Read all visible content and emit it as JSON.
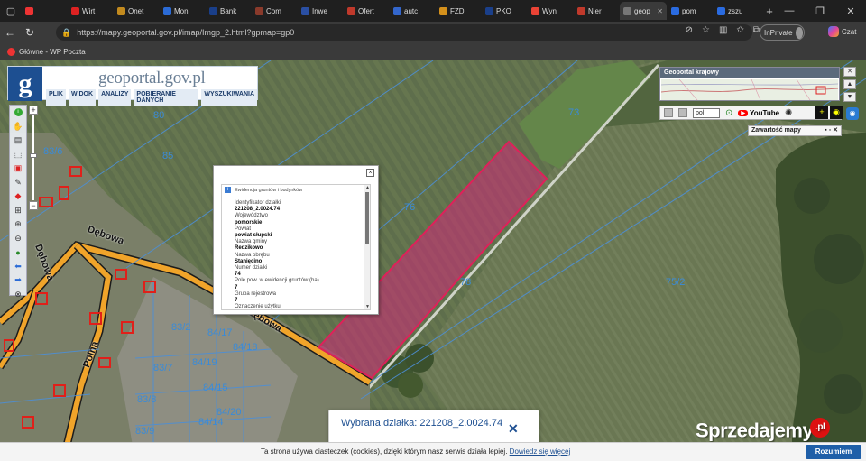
{
  "browser": {
    "tabs": [
      {
        "label": "",
        "color": "#e33"
      },
      {
        "label": "Wirt",
        "color": "#d22"
      },
      {
        "label": "Onet",
        "color": "#c28a1e"
      },
      {
        "label": "Mon",
        "color": "#2b6bd6"
      },
      {
        "label": "Bank",
        "color": "#1a3f8a"
      },
      {
        "label": "Com",
        "color": "#8a3a2b"
      },
      {
        "label": "Inwe",
        "color": "#2a4fa3"
      },
      {
        "label": "Ofert",
        "color": "#c0392b"
      },
      {
        "label": "autc",
        "color": "#3366cc"
      },
      {
        "label": "FZD",
        "color": "#d4901b"
      },
      {
        "label": "PKO",
        "color": "#1a3f8a"
      },
      {
        "label": "Wyn",
        "color": "#ea4335"
      },
      {
        "label": "Nier",
        "color": "#c0392b"
      },
      {
        "label": "geop",
        "color": "#777",
        "active": true
      },
      {
        "label": "pom",
        "color": "#2a6be0"
      },
      {
        "label": "zszu",
        "color": "#2a6be0"
      }
    ],
    "new_tab": "+",
    "url": "https://mapy.geoportal.gov.pl/imap/Imgp_2.html?gpmap=gp0",
    "inprivate": "InPrivate",
    "copilot": "Czat",
    "bookmark": "Główne - WP Poczta"
  },
  "geoportal": {
    "logo_letter": "g",
    "site_title": "geoportal.gov.pl",
    "menu": [
      "PLIK",
      "WIDOK",
      "ANALIZY",
      "POBIERANIE DANYCH",
      "WYSZUKIWANIA"
    ],
    "overview_title": "Geoportal krajowy",
    "language": "pol",
    "youtube": "YouTube",
    "map_contents": "Zawartość mapy"
  },
  "map_labels": {
    "parcels": [
      "80",
      "73",
      "76",
      "75/2",
      "78",
      "83/2",
      "84/17",
      "84/18",
      "84/19",
      "84/15",
      "84/14",
      "84/20",
      "83/7",
      "83/8",
      "83/9",
      "83/6",
      "85"
    ],
    "streets": [
      "Dębowa",
      "Dębowa",
      "Dębowa",
      "Polna"
    ]
  },
  "popup": {
    "header": "Ewidencja gruntów i budynków",
    "fields": [
      {
        "label": "Identyfikator działki",
        "value": "221208_2.0024.74"
      },
      {
        "label": "Województwo",
        "value": "pomorskie"
      },
      {
        "label": "Powiat",
        "value": "powiat słupski"
      },
      {
        "label": "Nazwa gminy",
        "value": "Redzikowo"
      },
      {
        "label": "Nazwa obrębu",
        "value": "Stanięcino"
      },
      {
        "label": "Numer działki",
        "value": "74"
      },
      {
        "label": "Pole pow. w ewidencji gruntów (ha)",
        "value": "7"
      },
      {
        "label": "Grupa rejestrowa",
        "value": "7"
      },
      {
        "label": "Oznaczenie użytku",
        "value": ""
      },
      {
        "label": "Oznaczenie konturu",
        "value": ""
      }
    ]
  },
  "selection": {
    "text": "Wybrana działka: 221208_2.0024.74",
    "close": "✕"
  },
  "cookie": {
    "message": "Ta strona używa ciasteczek (cookies), dzięki którym nasz serwis działa lepiej.",
    "link": "Dowiedz się więcej",
    "button": "Rozumiem"
  },
  "watermark": {
    "text": "Sprzedajemy",
    "suffix": ".pl"
  }
}
